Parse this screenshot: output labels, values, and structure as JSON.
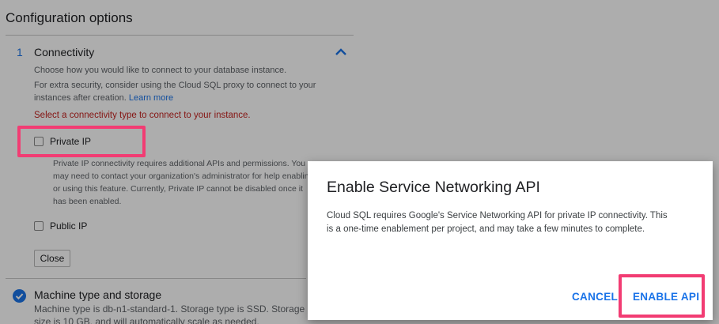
{
  "page": {
    "title": "Configuration options"
  },
  "connectivity": {
    "step_number": "1",
    "title": "Connectivity",
    "description1": "Choose how you would like to connect to your database instance.",
    "description2": "For extra security, consider using the Cloud SQL proxy to connect to your instances after creation.",
    "learn_more": "Learn more",
    "warning": "Select a connectivity type to connect to your instance.",
    "private_ip_label": "Private IP",
    "private_ip_note": "Private IP connectivity requires additional APIs and permissions. You may need to contact your organization's administrator for help enabling or using this feature. Currently, Private IP cannot be disabled once it has been enabled.",
    "public_ip_label": "Public IP",
    "close_label": "Close"
  },
  "machine": {
    "title": "Machine type and storage",
    "description": "Machine type is db-n1-standard-1. Storage type is SSD. Storage size is 10 GB, and will automatically scale as needed."
  },
  "dialog": {
    "title": "Enable Service Networking API",
    "body": "Cloud SQL requires Google's Service Networking API for private IP connectivity. This is a one-time enablement per project, and may take a few minutes to complete.",
    "cancel_label": "CANCEL",
    "enable_label": "ENABLE API"
  },
  "colors": {
    "accent": "#1a73e8",
    "warning": "#c5221f",
    "highlight": "#f23c73",
    "scrim": "rgba(0,0,0,0.32)"
  },
  "icons": {
    "collapse": "chevron-up-icon",
    "completed": "check-circle-icon"
  }
}
